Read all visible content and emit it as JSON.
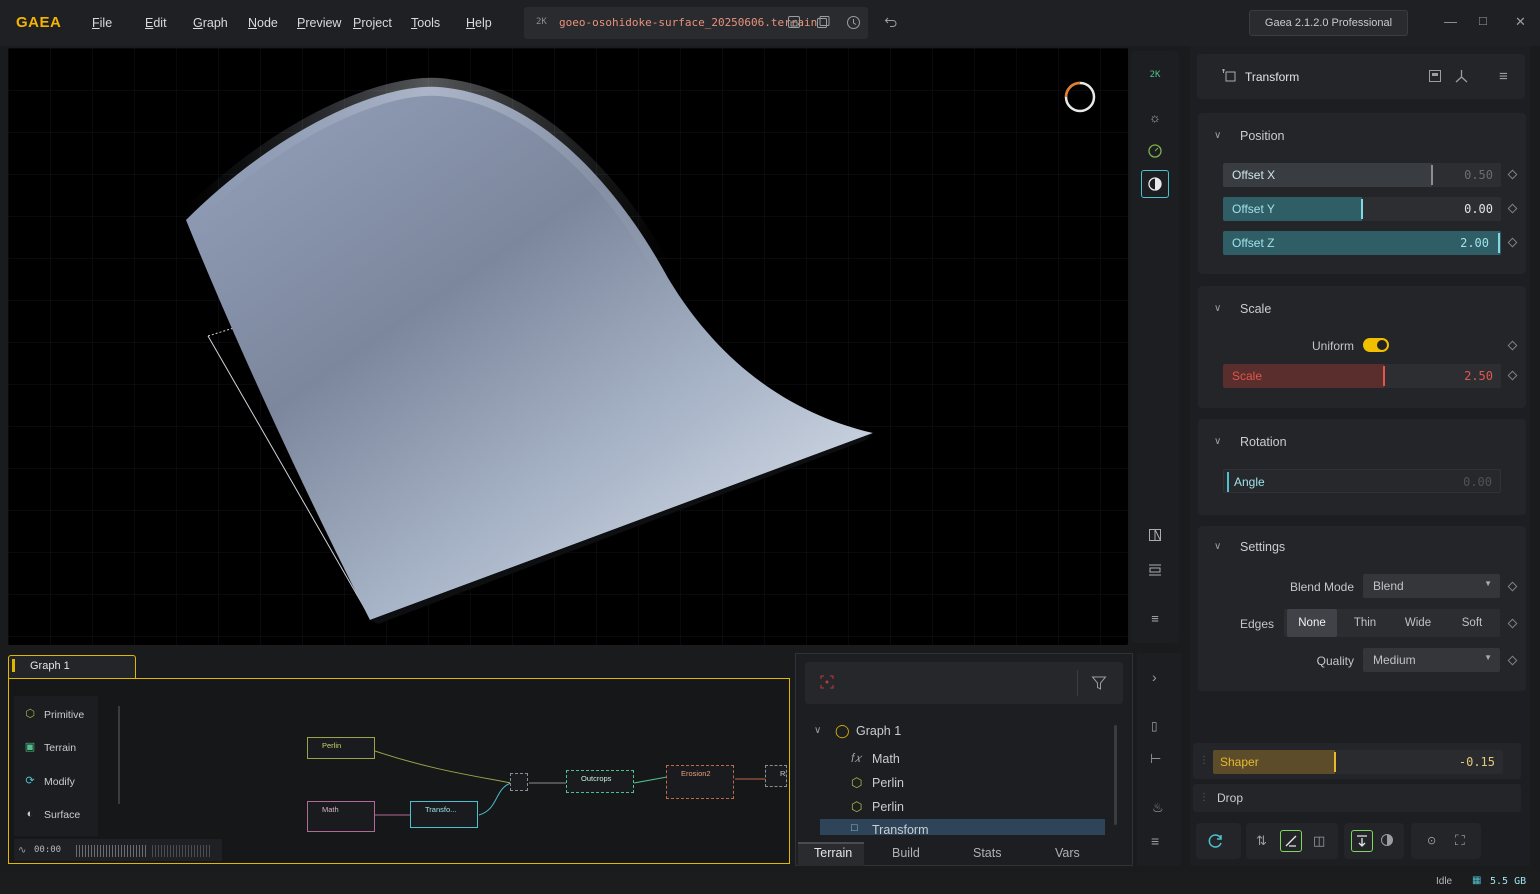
{
  "app": {
    "logo": "GAEA",
    "menu": [
      "File",
      "Edit",
      "Graph",
      "Node",
      "Preview",
      "Project",
      "Tools",
      "Help"
    ],
    "resolution_badge": "2K",
    "filename": "goeo-osohidoke-surface_20250606.terrain",
    "edition": "Gaea 2.1.2.0 Professional"
  },
  "viewport": {
    "resolution_badge": "2K",
    "tools": [
      "resolution",
      "sun-icon",
      "clock-icon",
      "shading-icon",
      "compare-icon",
      "layout-icon",
      "menu-icon"
    ]
  },
  "props": {
    "node_name": "Transform",
    "position": {
      "title": "Position",
      "offset_x": {
        "label": "Offset X",
        "value": "0.50",
        "fraction": 0.75
      },
      "offset_y": {
        "label": "Offset Y",
        "value": "0.00",
        "fraction": 0.5
      },
      "offset_z": {
        "label": "Offset Z",
        "value": "2.00",
        "fraction": 1.0
      }
    },
    "scale": {
      "title": "Scale",
      "uniform_label": "Uniform",
      "uniform": true,
      "scale": {
        "label": "Scale",
        "value": "2.50",
        "fraction": 0.58
      }
    },
    "rotation": {
      "title": "Rotation",
      "angle": {
        "label": "Angle",
        "value": "0.00",
        "fraction": 0.0
      }
    },
    "settings": {
      "title": "Settings",
      "blend_mode_label": "Blend Mode",
      "blend_mode": "Blend",
      "edges_label": "Edges",
      "edges_options": [
        "None",
        "Thin",
        "Wide",
        "Soft"
      ],
      "edges_selected": "None",
      "quality_label": "Quality",
      "quality": "Medium"
    },
    "shaper": {
      "label": "Shaper",
      "value": "-0.15",
      "fraction": 0.42
    },
    "drop_label": "Drop"
  },
  "graph": {
    "tab": "Graph 1",
    "categories": [
      "Primitive",
      "Terrain",
      "Modify",
      "Surface"
    ],
    "timer": "00:00",
    "nodes": {
      "perlin": "Perlin",
      "math": "Math",
      "transform": "Transfo...",
      "outcrops": "Outcrops",
      "erosion": "Erosion2",
      "cut": "Ri"
    }
  },
  "layers": {
    "root": "Graph 1",
    "items": [
      "Math",
      "Perlin",
      "Perlin",
      "Transform"
    ],
    "selected": "Transform",
    "tabs": [
      "Terrain",
      "Build",
      "Stats",
      "Vars"
    ],
    "active_tab": "Terrain"
  },
  "status": {
    "state": "Idle",
    "memory": "5.5 GB"
  },
  "colors": {
    "accent": "#f0c000",
    "cyan": "#4fc0cf",
    "scale_red": "#e0574e"
  }
}
